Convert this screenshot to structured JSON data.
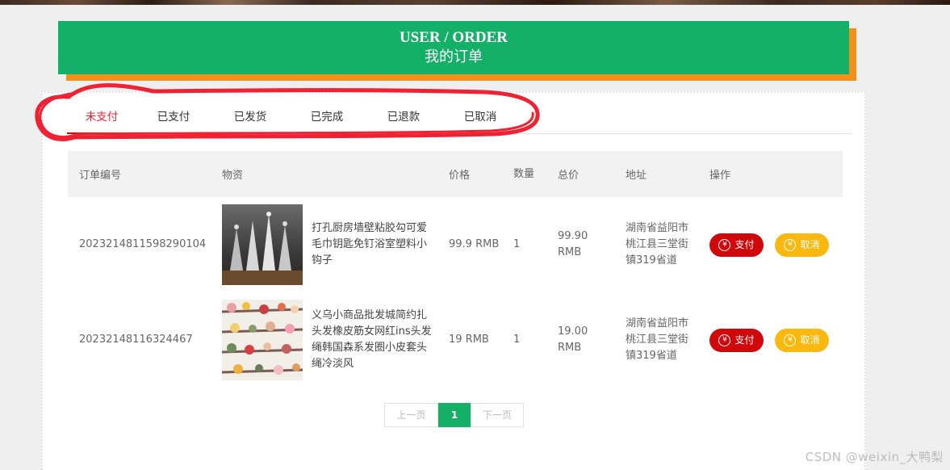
{
  "header": {
    "title_en": "USER / ORDER",
    "title_cn": "我的订单"
  },
  "tabs": [
    {
      "label": "未支付",
      "active": true
    },
    {
      "label": "已支付"
    },
    {
      "label": "已发货"
    },
    {
      "label": "已完成"
    },
    {
      "label": "已退款"
    },
    {
      "label": "已取消"
    }
  ],
  "table": {
    "headers": {
      "order_no": "订单编号",
      "goods": "物资",
      "price": "价格",
      "qty": "数量",
      "total": "总价",
      "address": "地址",
      "action": "操作"
    },
    "rows": [
      {
        "order_no": "2023214811598290104",
        "goods_name": "打孔厨房墙壁粘胶勾可爱毛巾钥匙免钉浴室塑料小钩子",
        "price": "99.9 RMB",
        "qty": "1",
        "total": "99.90 RMB",
        "address": "湖南省益阳市桃江县三堂街镇319省道",
        "pay": "支付",
        "cancel": "取消"
      },
      {
        "order_no": "20232148116324467",
        "goods_name": "义乌小商品批发城简约扎头发橡皮筋女网红ins头发绳韩国森系发圈小皮套头绳冷淡风",
        "price": "19 RMB",
        "qty": "1",
        "total": "19.00 RMB",
        "address": "湖南省益阳市桃江县三堂街镇319省道",
        "pay": "支付",
        "cancel": "取消"
      }
    ]
  },
  "pager": {
    "prev": "上一页",
    "current": "1",
    "next": "下一页"
  },
  "watermark": "CSDN @weixin_大鸭梨",
  "colors": {
    "brand_green": "#14b068",
    "accent_orange": "#f39019",
    "pay_red": "#d0080b",
    "cancel_yellow": "#fbb910",
    "annotation_red": "#ee2233"
  }
}
